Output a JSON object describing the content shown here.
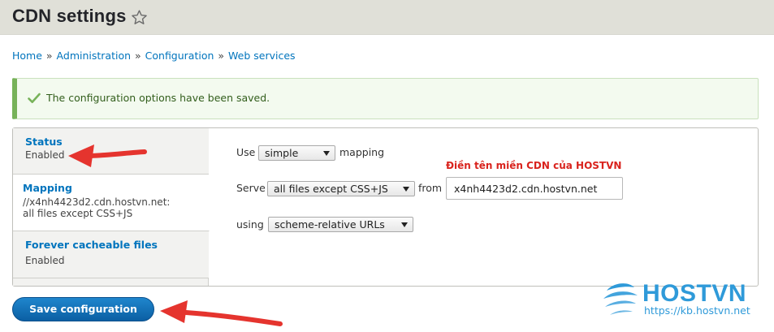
{
  "header": {
    "title": "CDN settings"
  },
  "breadcrumb": {
    "items": [
      "Home",
      "Administration",
      "Configuration",
      "Web services"
    ],
    "separator": "»"
  },
  "message": {
    "text": "The configuration options have been saved."
  },
  "tabs": [
    {
      "title": "Status",
      "summary_lines": [
        "Enabled"
      ]
    },
    {
      "title": "Mapping",
      "summary_lines": [
        "//x4nh4423d2.cdn.hostvn.net:",
        "all files except CSS+JS"
      ]
    },
    {
      "title": "Forever cacheable files",
      "summary_lines": [
        "Enabled"
      ]
    }
  ],
  "selected_tab": "Mapping",
  "mapping_form": {
    "use_label": "Use",
    "use_value": "simple",
    "mapping_label": "mapping",
    "serve_label": "Serve",
    "serve_value": "all files except CSS+JS",
    "from_label": "from",
    "domain_value": "x4nh4423d2.cdn.hostvn.net",
    "using_label": "using",
    "using_value": "scheme-relative URLs"
  },
  "annotation": {
    "text": "Điền tên miền CDN của HOSTVN"
  },
  "save_button": {
    "label": "Save configuration"
  },
  "watermark": {
    "brand": "HOSTVN",
    "url": "https://kb.hostvn.net"
  },
  "colors": {
    "link": "#0074bd",
    "success_border": "#77b259",
    "annotation_red": "#d9231d",
    "button_blue": "#0b6fb8",
    "brand_blue": "#2f9ad9"
  }
}
